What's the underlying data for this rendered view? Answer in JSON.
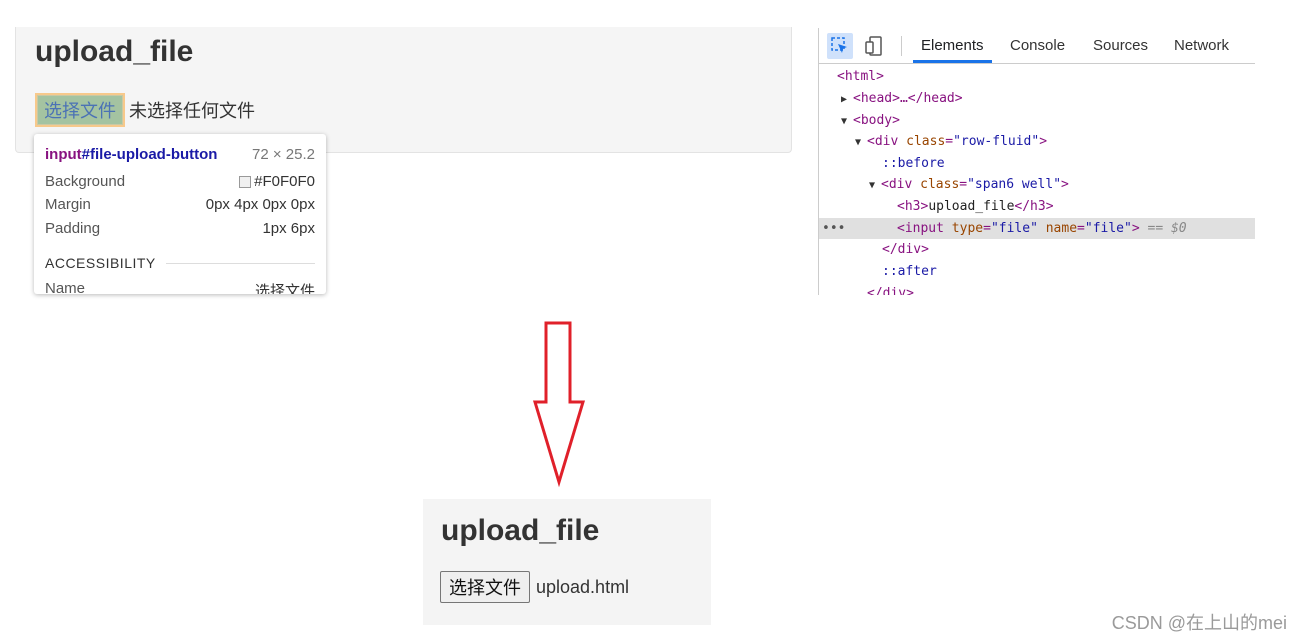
{
  "before": {
    "heading": "upload_file",
    "file_button_label": "选择文件",
    "no_file_text": "未选择任何文件",
    "tooltip": {
      "tag": "input",
      "id": "#file-upload-button",
      "size": "72 × 25.2",
      "rows": [
        {
          "label": "Background",
          "value": "#F0F0F0"
        },
        {
          "label": "Margin",
          "value": "0px 4px 0px 0px"
        },
        {
          "label": "Padding",
          "value": "1px 6px"
        }
      ],
      "accessibility_heading": "ACCESSIBILITY",
      "name_label": "Name",
      "name_value": "选择文件"
    }
  },
  "devtools": {
    "tabs": [
      "Elements",
      "Console",
      "Sources",
      "Network"
    ],
    "active_tab": "Elements",
    "dom_lines": {
      "html": "<html>",
      "head": "<head>…</head>",
      "body": "<body>",
      "div_row_open": "<div",
      "div_row_attr": "class",
      "div_row_val": "\"row-fluid\"",
      "before": "::before",
      "div_span_attr": "class",
      "div_span_val": "\"span6 well\"",
      "h3_text": "upload_file",
      "input_type_attr": "type",
      "input_type_val": "\"file\"",
      "input_name_attr": "name",
      "input_name_val": "\"file\"",
      "selected_marker": "== $0",
      "div_close": "</div>",
      "after": "::after"
    }
  },
  "after": {
    "heading": "upload_file",
    "file_button_label": "选择文件",
    "file_name": "upload.html"
  },
  "watermark": "CSDN @在上山的mei",
  "colors": {
    "arrow": "#e0202a",
    "devtools_accent": "#1a73e8",
    "tag": "#881280",
    "attr_name": "#994500",
    "attr_value": "#1a1aa6"
  }
}
